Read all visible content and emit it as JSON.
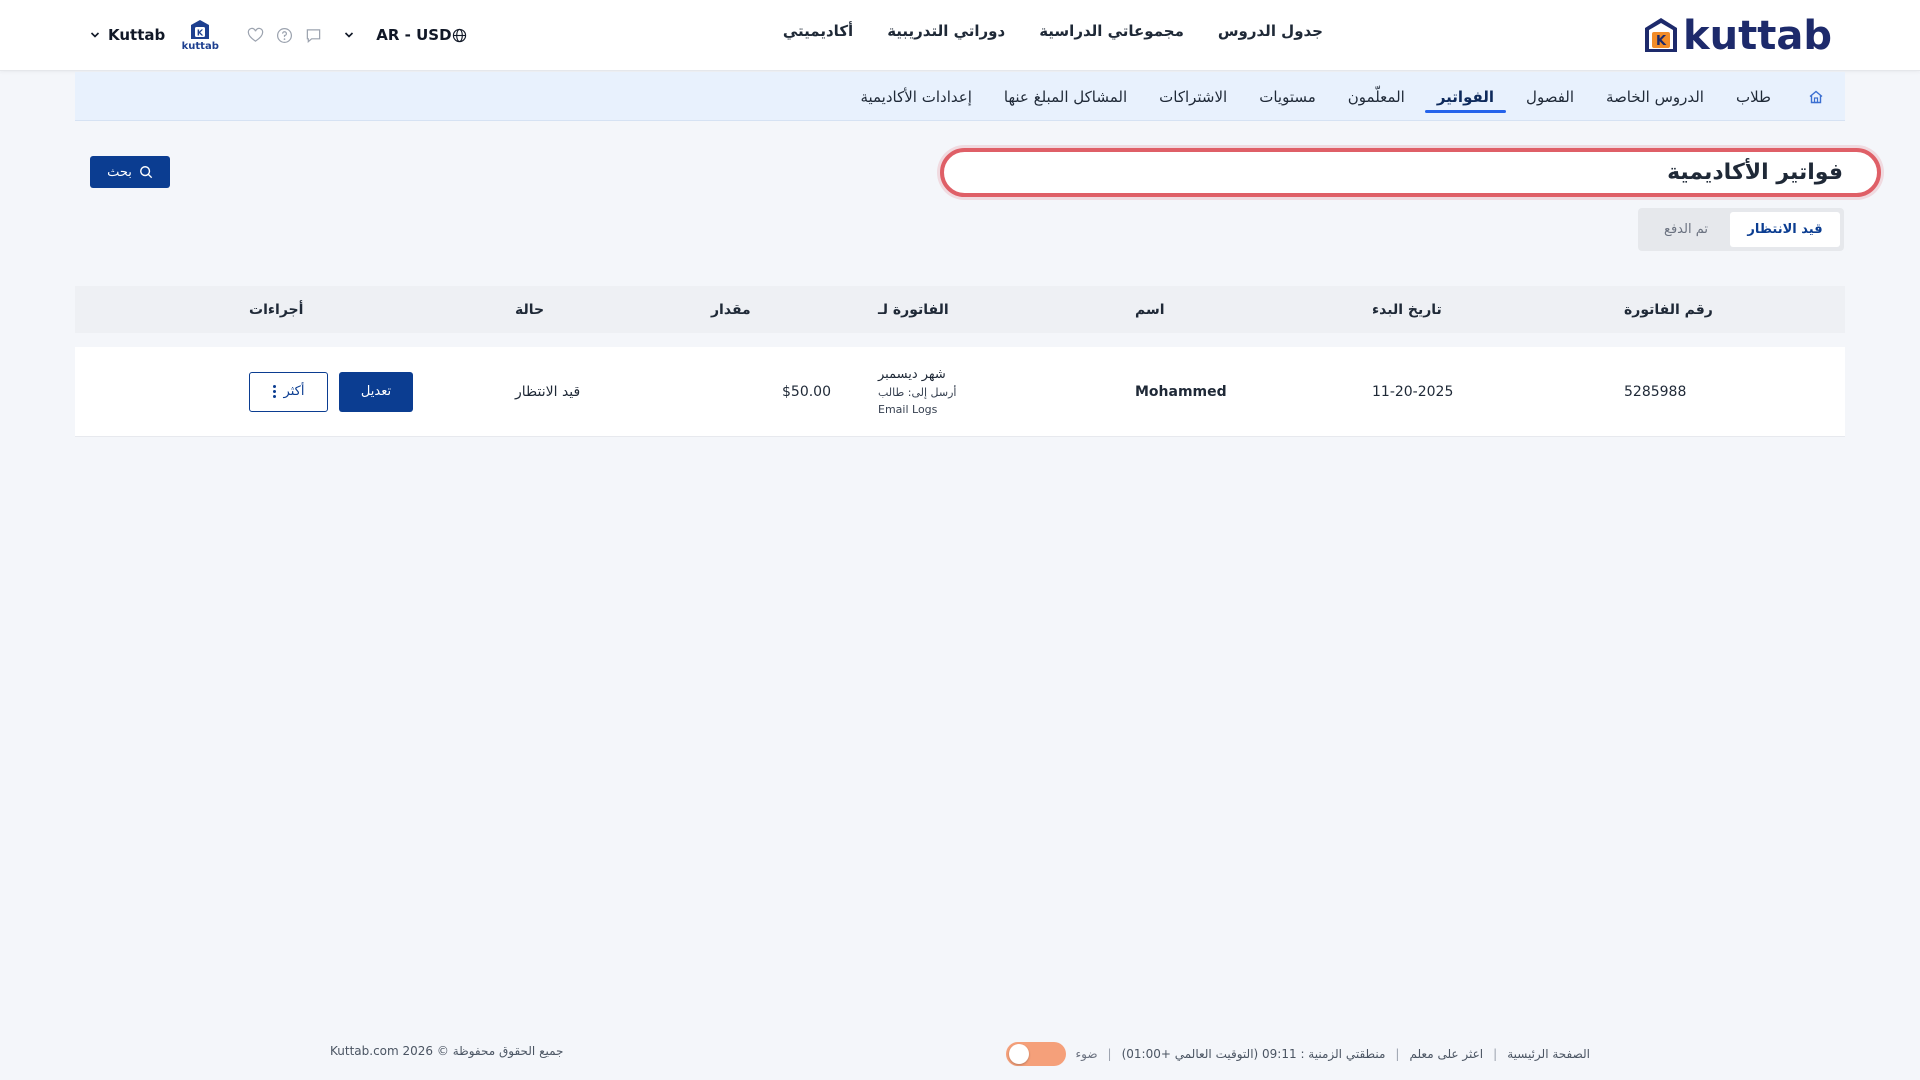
{
  "header": {
    "logo_text": "kuttab",
    "nav": [
      {
        "label": "جدول الدروس"
      },
      {
        "label": "مجموعاتي الدراسية"
      },
      {
        "label": "دوراتي التدريبية"
      },
      {
        "label": "أكاديميتي"
      }
    ],
    "account_name": "Kuttab",
    "account_logo_text": "kuttab",
    "locale": "AR - USD",
    "icons": [
      "chat-icon",
      "help-icon",
      "heart-icon",
      "globe-icon"
    ]
  },
  "subnav": {
    "home_icon": "home-icon",
    "items": [
      {
        "label": "طلاب",
        "active": false
      },
      {
        "label": "الدروس الخاصة",
        "active": false
      },
      {
        "label": "الفصول",
        "active": false
      },
      {
        "label": "الفواتير",
        "active": true
      },
      {
        "label": "المعلّمون",
        "active": false
      },
      {
        "label": "مستويات",
        "active": false
      },
      {
        "label": "الاشتراكات",
        "active": false
      },
      {
        "label": "المشاكل المبلغ عنها",
        "active": false
      },
      {
        "label": "إعدادات الأكاديمية",
        "active": false
      }
    ]
  },
  "page": {
    "title": "فواتير الأكاديمية",
    "search_label": "بحث"
  },
  "tabs": [
    {
      "label": "قيد الانتظار",
      "active": true
    },
    {
      "label": "تم الدفع",
      "active": false
    }
  ],
  "table": {
    "headers": {
      "invoice_no": "رقم الفاتورة",
      "start_date": "تاريخ البدء",
      "name": "اسم",
      "invoice_for": "الفاتورة لـ",
      "amount": "مقدار",
      "status": "حالة",
      "actions": "أجراءات"
    },
    "rows": [
      {
        "invoice_no": "5285988",
        "start_date": "11-20-2025",
        "name": "Mohammed",
        "invoice_for": "شهر ديسمبر",
        "send_to": "أرسل إلى: طالب",
        "email_logs": "Email Logs",
        "amount": "$50.00",
        "status": "قيد الانتظار",
        "edit_label": "تعديل",
        "more_label": "أكثر"
      }
    ]
  },
  "footer": {
    "home": "الصفحة الرئيسية",
    "find_teacher": "اعثر على معلم",
    "timezone": "منطقتي الزمنية : 09:11 (التوقيت العالمي +01:00)",
    "theme_label": "ضوء",
    "copyright": "جميع الحقوق محفوظة © 2026 Kuttab.com"
  },
  "colors": {
    "primary": "#0b3d91",
    "subnav_bg": "#e8f1fd",
    "highlight_ring": "#df5f67",
    "toggle": "#f5a07a"
  }
}
